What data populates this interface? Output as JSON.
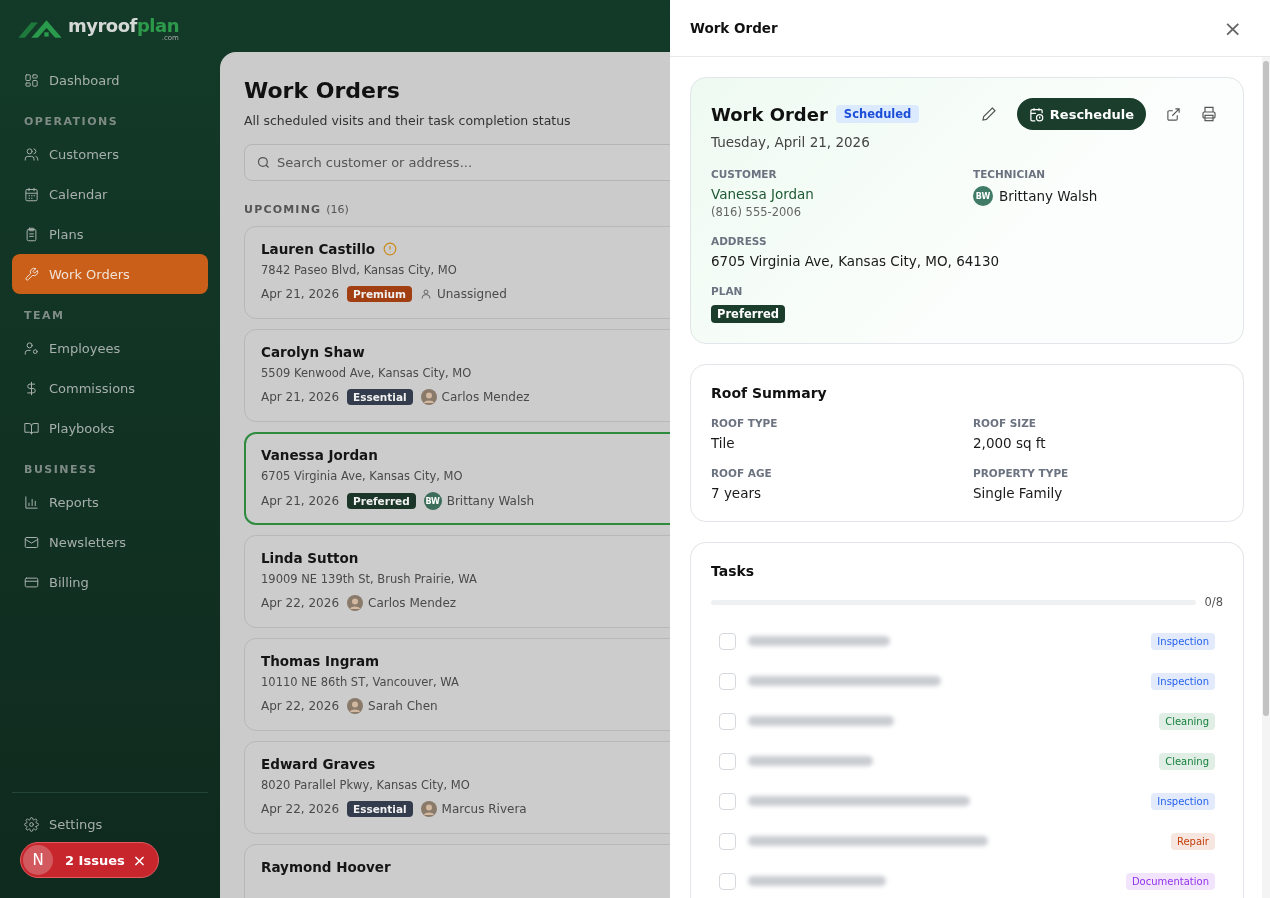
{
  "brand": {
    "name_main": "myroof",
    "name_accent": "plan",
    "suffix": ".com"
  },
  "sidebar": {
    "sections": [
      {
        "items": [
          {
            "label": "Dashboard",
            "selected": false
          }
        ]
      },
      {
        "heading": "OPERATIONS",
        "items": [
          {
            "label": "Customers",
            "selected": false
          },
          {
            "label": "Calendar",
            "selected": false
          },
          {
            "label": "Plans",
            "selected": false
          },
          {
            "label": "Work Orders",
            "selected": true
          }
        ]
      },
      {
        "heading": "TEAM",
        "items": [
          {
            "label": "Employees",
            "selected": false
          },
          {
            "label": "Commissions",
            "selected": false
          },
          {
            "label": "Playbooks",
            "selected": false
          }
        ]
      },
      {
        "heading": "BUSINESS",
        "items": [
          {
            "label": "Reports",
            "selected": false
          },
          {
            "label": "Newsletters",
            "selected": false
          },
          {
            "label": "Billing",
            "selected": false
          }
        ]
      }
    ],
    "footer": {
      "label": "Settings",
      "selected": false
    }
  },
  "issues_toast": {
    "initial": "N",
    "label": "2 Issues",
    "close": "×"
  },
  "page": {
    "title": "Work Orders",
    "subtitle": "All scheduled visits and their task completion status",
    "search": {
      "placeholder": "Search customer or address..."
    },
    "group_label": "UPCOMING",
    "group_count": "(16)"
  },
  "orders": [
    {
      "name": "Lauren Castillo",
      "warning": true,
      "address": "7842 Paseo Blvd, Kansas City, MO",
      "date": "Apr 21, 2026",
      "plan": {
        "label": "Premium",
        "color": "#a23f12"
      },
      "technician": {
        "kind": "unassigned",
        "name": "Unassigned"
      },
      "selected": false
    },
    {
      "name": "Carolyn Shaw",
      "warning": false,
      "address": "5509 Kenwood Ave, Kansas City, MO",
      "date": "Apr 21, 2026",
      "plan": {
        "label": "Essential",
        "color": "#333c4c"
      },
      "technician": {
        "kind": "photo",
        "name": "Carlos Mendez"
      },
      "selected": false
    },
    {
      "name": "Vanessa Jordan",
      "warning": false,
      "address": "6705 Virginia Ave, Kansas City, MO",
      "date": "Apr 21, 2026",
      "plan": {
        "label": "Preferred",
        "color": "#1b3628"
      },
      "technician": {
        "kind": "initials",
        "initials": "BW",
        "name": "Brittany Walsh"
      },
      "selected": true
    },
    {
      "name": "Linda Sutton",
      "warning": false,
      "address": "19009 NE 139th St, Brush Prairie, WA",
      "date": "Apr 22, 2026",
      "technician": {
        "kind": "photo",
        "name": "Carlos Mendez"
      },
      "selected": false
    },
    {
      "name": "Thomas Ingram",
      "warning": false,
      "address": "10110 NE 86th ST, Vancouver, WA",
      "date": "Apr 22, 2026",
      "technician": {
        "kind": "photo",
        "name": "Sarah Chen"
      },
      "selected": false
    },
    {
      "name": "Edward Graves",
      "warning": false,
      "address": "8020 Parallel Pkwy, Kansas City, MO",
      "date": "Apr 22, 2026",
      "plan": {
        "label": "Essential",
        "color": "#333c4c"
      },
      "technician": {
        "kind": "photo",
        "name": "Marcus Rivera"
      },
      "selected": false
    },
    {
      "name": "Raymond Hoover",
      "warning": false,
      "selected": false
    }
  ],
  "drawer": {
    "title": "Work Order",
    "close": "×",
    "header": {
      "title": "Work Order",
      "status": "Scheduled",
      "date": "Tuesday, April 21, 2026",
      "action": "Reschedule"
    },
    "customer": {
      "label": "CUSTOMER",
      "name": "Vanessa Jordan",
      "phone": "(816) 555-2006"
    },
    "technician": {
      "label": "TECHNICIAN",
      "initials": "BW",
      "name": "Brittany Walsh"
    },
    "address": {
      "label": "ADDRESS",
      "value": "6705 Virginia Ave, Kansas City, MO, 64130"
    },
    "plan": {
      "label": "PLAN",
      "value": "Preferred"
    },
    "roof_summary": {
      "title": "Roof Summary",
      "fields": [
        {
          "label": "ROOF TYPE",
          "value": "Tile"
        },
        {
          "label": "ROOF SIZE",
          "value": "2,000 sq ft"
        },
        {
          "label": "ROOF AGE",
          "value": "7 years"
        },
        {
          "label": "PROPERTY TYPE",
          "value": "Single Family"
        }
      ]
    },
    "tasks": {
      "title": "Tasks",
      "level": 0,
      "count": "0/8",
      "items": [
        {
          "checked": false,
          "tag": "Inspection",
          "color": "#2563eb"
        },
        {
          "checked": false,
          "tag": "Inspection",
          "color": "#2563eb"
        },
        {
          "checked": false,
          "tag": "Cleaning",
          "color": "#15803d"
        },
        {
          "checked": false,
          "tag": "Cleaning",
          "color": "#15803d"
        },
        {
          "checked": false,
          "tag": "Inspection",
          "color": "#2563eb"
        },
        {
          "checked": false,
          "tag": "Repair",
          "color": "#c2410c"
        },
        {
          "checked": false,
          "tag": "Documentation",
          "color": "#9333ea"
        }
      ]
    }
  }
}
